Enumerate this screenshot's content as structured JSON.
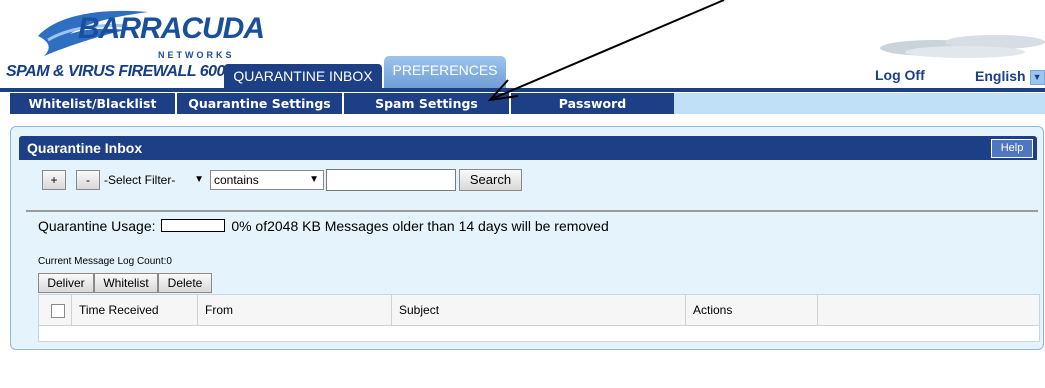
{
  "brand": {
    "logo_text": "BARRACUDA",
    "logo_sub": "NETWORKS",
    "product": "SPAM & VIRUS FIREWALL 600"
  },
  "top_tabs": {
    "quarantine_inbox": "QUARANTINE INBOX",
    "preferences": "PREFERENCES"
  },
  "header_links": {
    "log_off": "Log Off",
    "language": "English"
  },
  "subnav": [
    {
      "label": "Whitelist/Blacklist"
    },
    {
      "label": "Quarantine Settings"
    },
    {
      "label": "Spam Settings"
    },
    {
      "label": "Password"
    }
  ],
  "panel": {
    "title": "Quarantine Inbox",
    "help_label": "Help"
  },
  "filter": {
    "add_label": "+",
    "remove_label": "-",
    "filter_select": "-Select Filter-",
    "condition_select": "contains",
    "search_value": "",
    "search_label": "Search"
  },
  "usage": {
    "label": "Quarantine Usage:",
    "percent": 0,
    "text": "0% of2048 KB  Messages older than 14 days will be removed"
  },
  "log": {
    "count_text": "Current Message Log Count:0"
  },
  "actions": {
    "deliver": "Deliver",
    "whitelist": "Whitelist",
    "delete": "Delete"
  },
  "table": {
    "columns": [
      "Time Received",
      "From",
      "Subject",
      "Actions"
    ]
  },
  "colors": {
    "navy": "#1d3f86",
    "tab_light": "#9cc4ee",
    "panel_bg": "#e4f3fc"
  }
}
